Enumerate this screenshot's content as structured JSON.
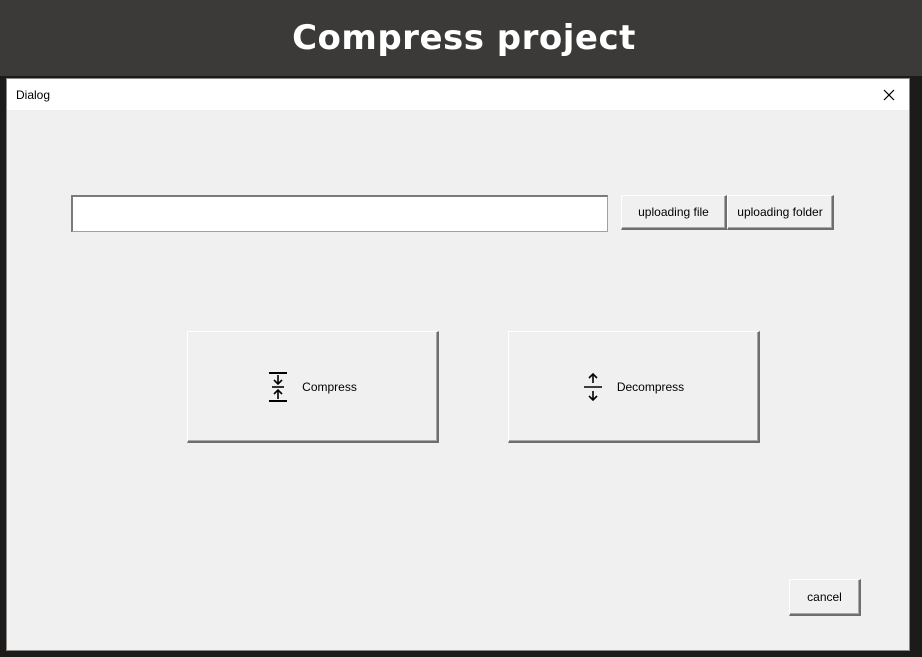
{
  "banner": {
    "title": "Compress project"
  },
  "dialog": {
    "title": "Dialog",
    "close_icon": "close-icon"
  },
  "path_input": {
    "value": "",
    "placeholder": ""
  },
  "buttons": {
    "upload_file": "uploading file",
    "upload_folder": "uploading folder",
    "compress": "Compress",
    "compress_icon": "compress-icon",
    "decompress": "Decompress",
    "decompress_icon": "expand-icon",
    "cancel": "cancel"
  }
}
